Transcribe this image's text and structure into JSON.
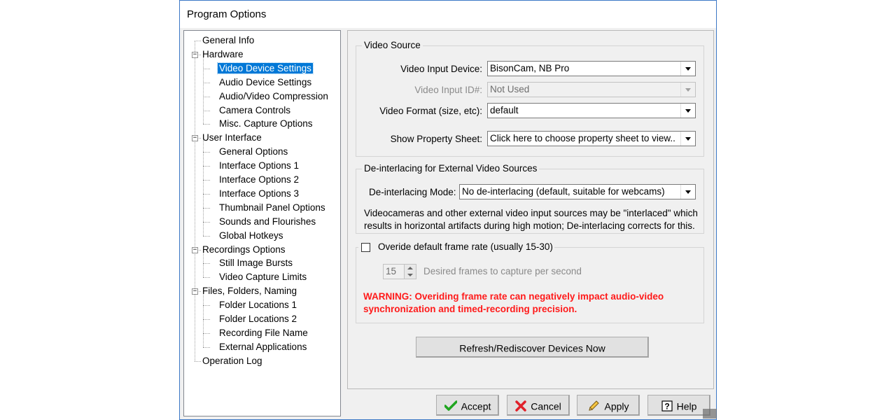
{
  "window": {
    "title": "Program Options"
  },
  "tree": {
    "items": [
      {
        "label": "General Info",
        "level": 0
      },
      {
        "label": "Hardware",
        "level": 0,
        "expander": "−"
      },
      {
        "label": "Video Device Settings",
        "level": 1,
        "selected": true
      },
      {
        "label": "Audio Device Settings",
        "level": 1
      },
      {
        "label": "Audio/Video Compression",
        "level": 1
      },
      {
        "label": "Camera Controls",
        "level": 1
      },
      {
        "label": "Misc. Capture Options",
        "level": 1
      },
      {
        "label": "User Interface",
        "level": 0,
        "expander": "−"
      },
      {
        "label": "General Options",
        "level": 1
      },
      {
        "label": "Interface Options 1",
        "level": 1
      },
      {
        "label": "Interface Options 2",
        "level": 1
      },
      {
        "label": "Interface Options 3",
        "level": 1
      },
      {
        "label": "Thumbnail Panel Options",
        "level": 1
      },
      {
        "label": "Sounds and Flourishes",
        "level": 1
      },
      {
        "label": "Global Hotkeys",
        "level": 1
      },
      {
        "label": "Recordings Options",
        "level": 0,
        "expander": "−"
      },
      {
        "label": "Still Image Bursts",
        "level": 1
      },
      {
        "label": "Video Capture Limits",
        "level": 1
      },
      {
        "label": "Files, Folders, Naming",
        "level": 0,
        "expander": "−"
      },
      {
        "label": "Folder Locations 1",
        "level": 1
      },
      {
        "label": "Folder Locations 2",
        "level": 1
      },
      {
        "label": "Recording File Name",
        "level": 1
      },
      {
        "label": "External Applications",
        "level": 1
      },
      {
        "label": "Operation Log",
        "level": 0
      }
    ]
  },
  "video_source": {
    "title": "Video Source",
    "input_device_label": "Video Input Device:",
    "input_device_value": "BisonCam, NB Pro",
    "input_id_label": "Video Input ID#:",
    "input_id_value": "Not Used",
    "format_label": "Video Format (size, etc):",
    "format_value": "default",
    "property_sheet_label": "Show Property Sheet:",
    "property_sheet_value": "Click here to choose property sheet to view.."
  },
  "deinterlacing": {
    "title": "De-interlacing for External Video Sources",
    "mode_label": "De-interlacing Mode:",
    "mode_value": "No de-interlacing (default, suitable for webcams)",
    "desc_line1": "Videocameras and other external video input sources may be \"interlaced\" which",
    "desc_line2": "results in horizontal artifacts during high motion; De-interlacing corrects for this."
  },
  "frame_rate": {
    "override_label": "Overide default frame rate (usually 15-30)",
    "override_checked": false,
    "fps_value": "15",
    "fps_label": "Desired frames to capture per second",
    "warning_line1": "WARNING: Overiding frame rate can negatively impact audio-video",
    "warning_line2": "synchronization and timed-recording precision.",
    "warning_color": "#ff1a1a"
  },
  "buttons": {
    "refresh": "Refresh/Rediscover Devices Now",
    "accept": "Accept",
    "cancel": "Cancel",
    "apply": "Apply",
    "help": "Help"
  },
  "colors": {
    "selection": "#0078d7",
    "window_border": "#3c78c6"
  }
}
